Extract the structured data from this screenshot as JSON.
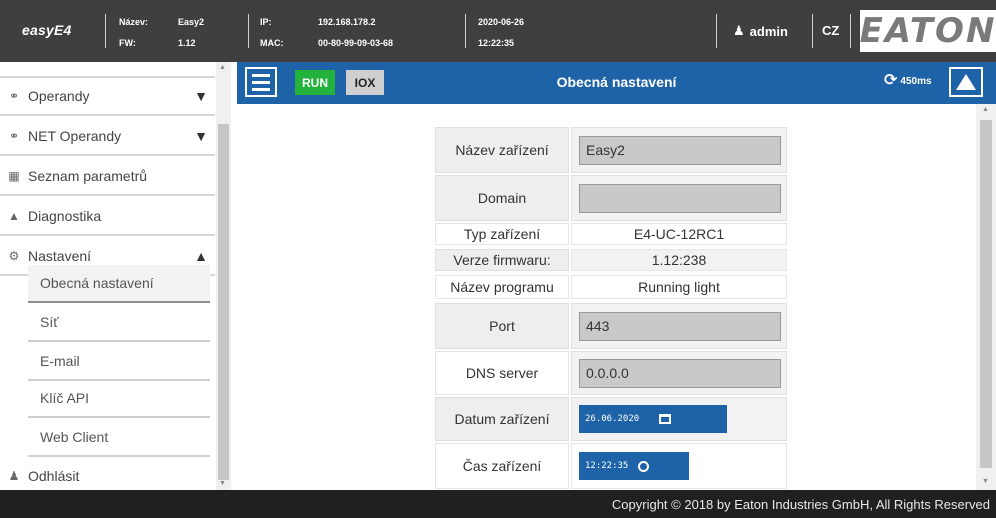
{
  "header": {
    "brand": "easyE4",
    "name_label": "Název:",
    "name_value": "Easy2",
    "fw_label": "FW:",
    "fw_value": "1.12",
    "ip_label": "IP:",
    "ip_value": "192.168.178.2",
    "mac_label": "MAC:",
    "mac_value": "00-80-99-09-03-68",
    "date": "2020-06-26",
    "time": "12:22:35",
    "user": "admin",
    "language": "CZ",
    "logo_text": "EATON"
  },
  "sidebar": {
    "items": [
      {
        "label": "Operandy",
        "icon": "link-icon",
        "arrow": "▼"
      },
      {
        "label": "NET Operandy",
        "icon": "link-icon",
        "arrow": "▼"
      },
      {
        "label": "Seznam parametrů",
        "icon": "list-icon"
      },
      {
        "label": "Diagnostika",
        "icon": "warning-icon"
      },
      {
        "label": "Nastavení",
        "icon": "gear-icon",
        "arrow": "▲"
      }
    ],
    "subitems": [
      {
        "label": "Obecná nastavení",
        "active": true
      },
      {
        "label": "Síť"
      },
      {
        "label": "E-mail"
      },
      {
        "label": "Klíč API"
      },
      {
        "label": "Web Client"
      }
    ],
    "logout": "Odhlásit"
  },
  "toolbar": {
    "run": "RUN",
    "iox": "IOX",
    "title": "Obecná nastavení",
    "refresh": "450ms"
  },
  "form": {
    "device_name_label": "Název zařízení",
    "device_name_value": "Easy2",
    "domain_label": "Domain",
    "domain_value": "",
    "device_type_label": "Typ zařízení",
    "device_type_value": "E4-UC-12RC1",
    "firmware_label": "Verze firmwaru:",
    "firmware_value": "1.12:238",
    "program_label": "Název programu",
    "program_value": "Running light",
    "port_label": "Port",
    "port_value": "443",
    "dns_label": "DNS server",
    "dns_value": "0.0.0.0",
    "date_label": "Datum zařízení",
    "date_value": "26.06.2020",
    "time_label": "Čas zařízení",
    "time_value": "12:22:35"
  },
  "colors": {
    "header_bg": "#3f3f3f",
    "accent_blue": "#1e62a8",
    "run_green": "#23b23c",
    "footer_bg": "#202020"
  },
  "footer": {
    "copyright": "Copyright © 2018 by Eaton Industries GmbH, All Rights Reserved"
  }
}
